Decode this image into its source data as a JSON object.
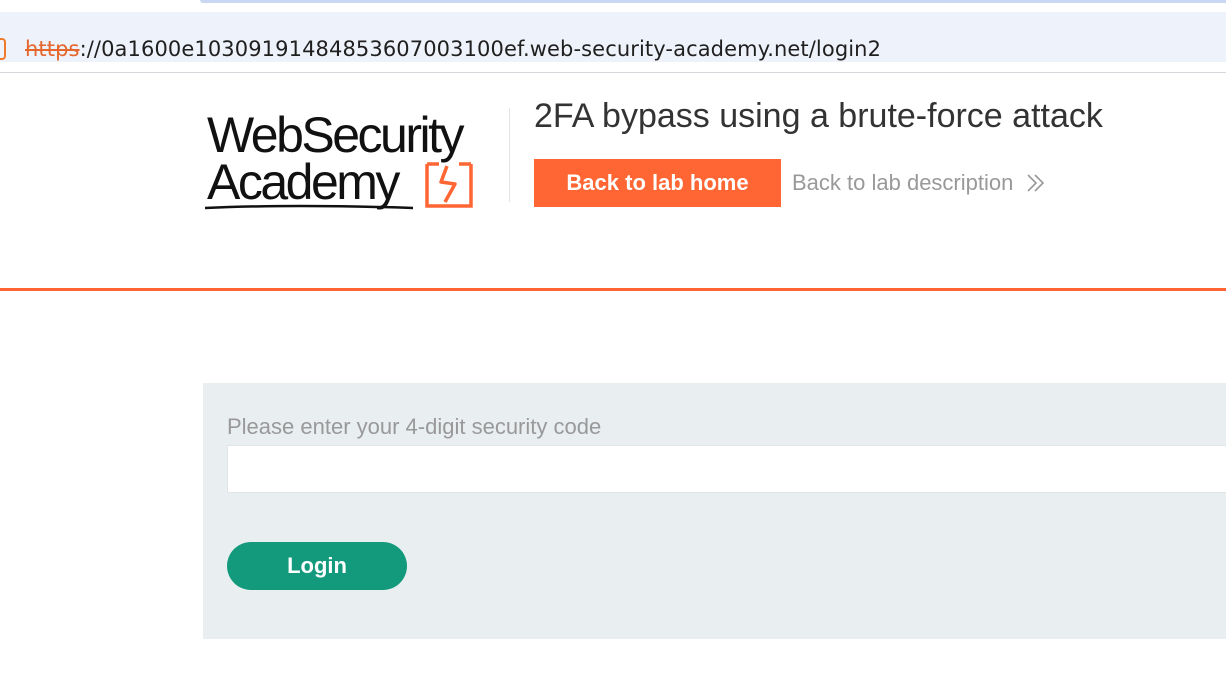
{
  "browser": {
    "url_scheme": "https",
    "url_rest": "://0a1600e1030919148485360700310​0ef.web-security-academy.net/login2"
  },
  "header": {
    "logo": {
      "line1": "WebSecurity",
      "line2": "Academy"
    },
    "lab_title": "2FA bypass using a brute-force attack",
    "back_home_label": "Back to lab home",
    "back_description_label": "Back to lab description"
  },
  "form": {
    "code_label": "Please enter your 4-digit security code",
    "code_value": "",
    "login_label": "Login"
  },
  "colors": {
    "accent": "#ff6633",
    "login_button": "#139a7d",
    "panel_background": "#e9eef1"
  }
}
